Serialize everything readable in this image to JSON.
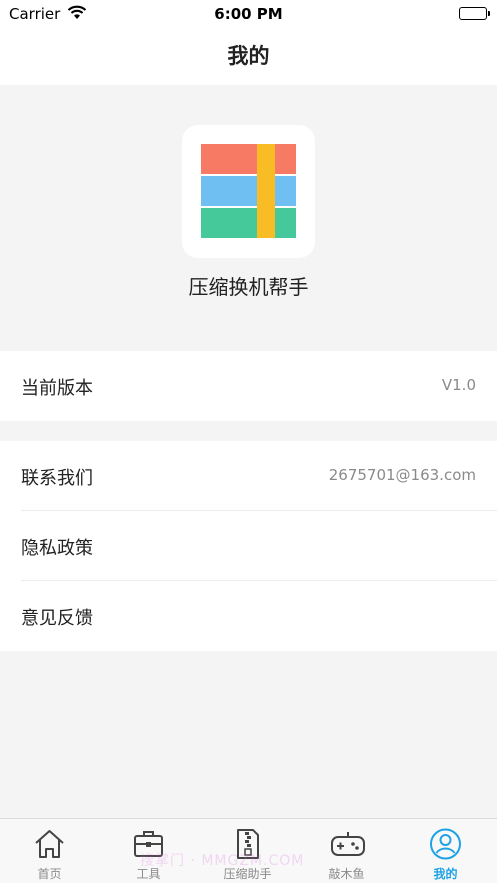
{
  "status_bar": {
    "carrier": "Carrier",
    "time": "6:00 PM"
  },
  "nav": {
    "title": "我的"
  },
  "app": {
    "name": "压缩换机帮手",
    "icon": "app-logo-icon"
  },
  "settings": {
    "version": {
      "label": "当前版本",
      "value": "V1.0"
    },
    "contact": {
      "label": "联系我们",
      "value": "2675701@163.com"
    },
    "privacy": {
      "label": "隐私政策"
    },
    "feedback": {
      "label": "意见反馈"
    }
  },
  "tabs": [
    {
      "label": "首页",
      "icon": "home-icon"
    },
    {
      "label": "工具",
      "icon": "toolbox-icon"
    },
    {
      "label": "压缩助手",
      "icon": "zip-file-icon"
    },
    {
      "label": "敲木鱼",
      "icon": "gamepad-icon"
    },
    {
      "label": "我的",
      "icon": "user-icon",
      "active": true
    }
  ],
  "watermark": "搜掌门 · MMGZM.COM",
  "colors": {
    "accent": "#1ea2e6",
    "logo_red": "#f77a65",
    "logo_blue": "#6fbff2",
    "logo_green": "#45c99b",
    "logo_yellow": "#f8bd25"
  }
}
